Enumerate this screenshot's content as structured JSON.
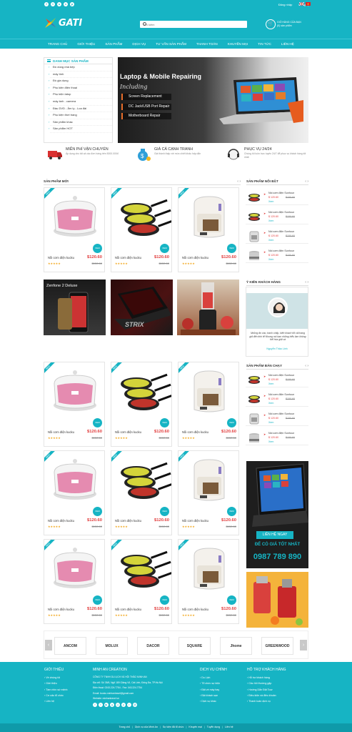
{
  "topbar": {
    "social": [
      "f",
      "t",
      "s",
      "v",
      "p"
    ],
    "login": "Đăng nhập",
    "register": "Đăng ký"
  },
  "header": {
    "logo": "GATI",
    "search_placeholder": "Tìm kiếm",
    "cart_line1": "GIỎ HÀNG CỦA BẠN",
    "cart_line2": "(0) sản phẩm"
  },
  "nav": [
    "TRANG CHỦ",
    "GIỚI THIỆU",
    "SẢN PHẨM",
    "DỊCH VỤ",
    "TƯ VẤN SẢN PHẨM",
    "THANH TOÁN",
    "KHUYẾN MẠI",
    "TIN TỨC",
    "LIÊN HỆ"
  ],
  "categories": {
    "title": "DANH MỤC SẢN PHẨM",
    "items": [
      "Đồ dùng nhà bếp",
      "máy tính",
      "Đồ gia dụng",
      "Phụ kiện điện thoại",
      "Phụ kiện latop",
      "máy ảnh - camera",
      "Đầu DVD - Âm ly - Loa đài",
      "Phụ kiện thời trang",
      "Sản phẩm khác",
      "Sản phẩm HOT"
    ]
  },
  "slider": {
    "heading": "Laptop & Mobile Repairing",
    "including": "Including",
    "features": [
      "Screen Replacement",
      "DC Jack/USB Port Repair",
      "Motherboard Repair"
    ]
  },
  "features": [
    {
      "title": "MIỄN PHÍ VẬN CHUYỂN",
      "desc": "Áp dụng cho tất cả các đơn hàng trên 5000.000đ"
    },
    {
      "title": "GIÁ CẢ CẠNH TRANH",
      "desc": "Giá thành thấp với mức chiết khấu hấp dẫn"
    },
    {
      "title": "PHỤC VỤ 24/24",
      "desc": "Chúng tôi luôn trực tuyến 24/7 để phục vụ khách hàng tốt nhất"
    }
  ],
  "section_new": "SẢN PHẨM MỚI",
  "section_featured": "SẢN PHẨM NỔI BẬT",
  "section_reviews": "Ý KIẾN KHÁCH HÀNG",
  "section_bestseller": "SẢN PHẨM BÁN CHẠY",
  "product": {
    "badge": "NEW",
    "name": "Nồi cơm điện kucku",
    "price": "$120.60",
    "old_price": "$150.60",
    "stars": "★★★★★",
    "view": "XEM"
  },
  "products_top": [
    {
      "type": "cooker"
    },
    {
      "type": "pans"
    },
    {
      "type": "fryer"
    }
  ],
  "banners": [
    "Zenfone 2 Deluxe",
    "STRIX",
    ""
  ],
  "side_product": {
    "name": "Nồi cơm điện Sunhour",
    "price": "$ 120.60",
    "old_price": "$150.60",
    "view": "Xem"
  },
  "review": {
    "text": "Những ấn cáo, tranh chấp, kiến khách tốt cải trang giả đến tinh tế Nhưng nói bạn những hiểu lầm không thể hóa giải và",
    "name": "Nguyễn Thảo Linh"
  },
  "promo": {
    "cta": "LIÊN HỆ NGAY",
    "tagline": "ĐỂ CÓ GIÁ TỐT NHẤT",
    "phone": "0987 789 890"
  },
  "brands": [
    "ANCOM",
    "MOLUX",
    "DACOR",
    "SQUARE",
    "Jhome",
    "GREENWOOD"
  ],
  "footer": {
    "col1": {
      "title": "GIỚI THIỆU",
      "items": [
        "Về chúng tôi",
        "Giới thiệu",
        "Tầm nhìn sứ mệnh",
        "Cơ cấu tổ chức",
        "Liên hệ"
      ]
    },
    "col2": {
      "title": "MINH AN CREATION",
      "lines": [
        "CÔNG TY TNHH DU LỊCH VÀ HỘI THẢO MINH AN",
        "Địa chỉ: Số 35/8, Ngõ 189 Giảng Võ, Cát Linh, Đống Đa, TP.Hà Nội",
        "Điện thoại: 0243.224.7754 - Fax: 043.224.7754",
        "Email: booko.minhantravel@gmail.com",
        "Website: minhantravel.vn"
      ]
    },
    "col3": {
      "title": "DỊCH VỤ CHÍNH",
      "items": [
        "Du Lịch",
        "Tổ chức sự kiện",
        "Đặt vé máy bay",
        "Đặt khách sạn",
        "Dịch vụ khác"
      ]
    },
    "col4": {
      "title": "HỖ TRỢ KHÁCH HÀNG",
      "items": [
        "Hỗ trợ khách hàng",
        "Câu hỏi thường gặp",
        "Hướng Dẫn Đặt Tour",
        "Điều kiện và điều khoản",
        "Thanh toán dịch vụ"
      ]
    }
  },
  "bottom_links": [
    "Trang chủ",
    "Dịch vụ của Minh An",
    "Sự kiện đã tổ chức",
    "Khuyến mại",
    "Tuyển dụng",
    "Liên hệ"
  ]
}
